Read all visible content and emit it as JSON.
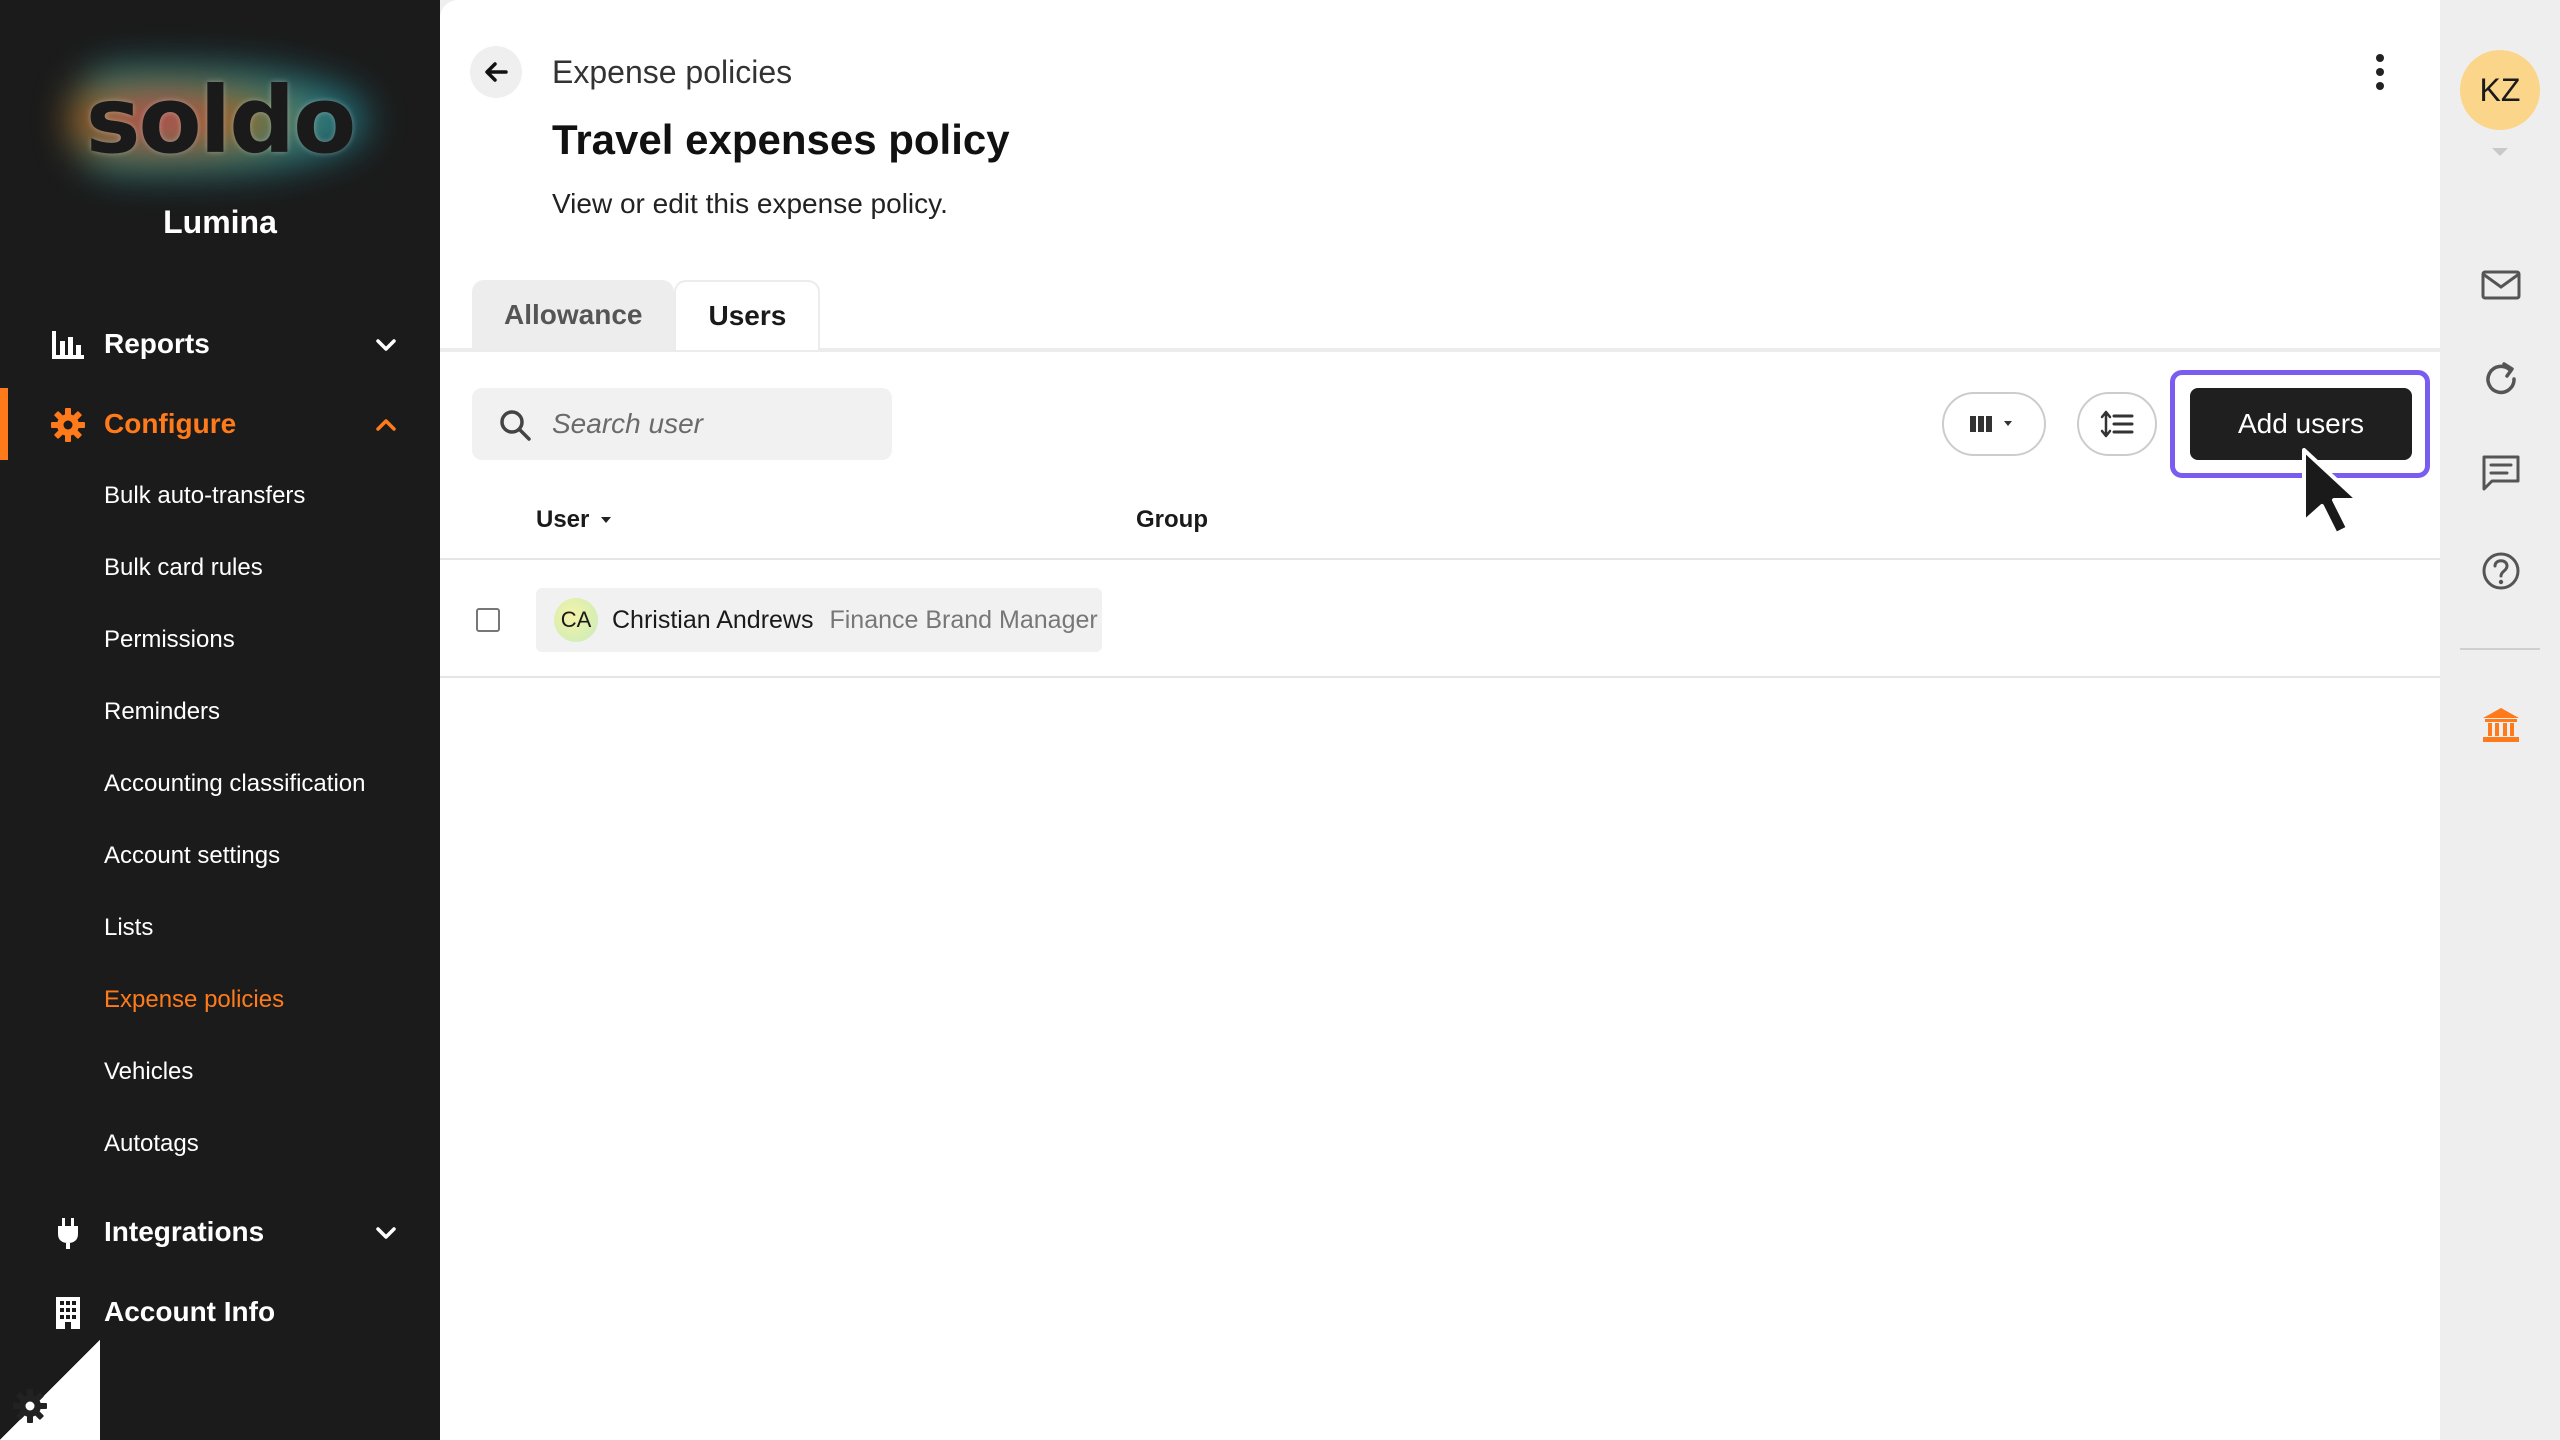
{
  "brand": {
    "logo": "soldo",
    "org_name": "Lumina",
    "accent": "#ff7a1a"
  },
  "sidebar": {
    "main_items": [
      {
        "label": "Reports",
        "icon": "bar-chart-icon",
        "expanded": false
      },
      {
        "label": "Configure",
        "icon": "gear-icon",
        "expanded": true,
        "active": true
      },
      {
        "label": "Integrations",
        "icon": "plug-icon",
        "expanded": false
      },
      {
        "label": "Account Info",
        "icon": "building-icon"
      }
    ],
    "configure_items": [
      "Bulk auto-transfers",
      "Bulk card rules",
      "Permissions",
      "Reminders",
      "Accounting classification",
      "Account settings",
      "Lists",
      "Expense policies",
      "Vehicles",
      "Autotags"
    ],
    "active_sub": "Expense policies"
  },
  "header": {
    "breadcrumb": "Expense policies",
    "title": "Travel expenses policy",
    "subtitle": "View or edit this expense policy."
  },
  "tabs": [
    {
      "label": "Allowance",
      "active": false
    },
    {
      "label": "Users",
      "active": true
    }
  ],
  "toolbar": {
    "search_placeholder": "Search user",
    "add_users_label": "Add users",
    "highlight_color": "#7b5cf0"
  },
  "table": {
    "columns": [
      "User",
      "Group"
    ],
    "rows": [
      {
        "initials": "CA",
        "name": "Christian Andrews",
        "role": "Finance Brand Manager",
        "group": ""
      }
    ]
  },
  "rail": {
    "user_initials": "KZ",
    "icons": [
      "mail-icon",
      "refresh-icon",
      "chat-icon",
      "help-icon",
      "bank-icon"
    ]
  }
}
